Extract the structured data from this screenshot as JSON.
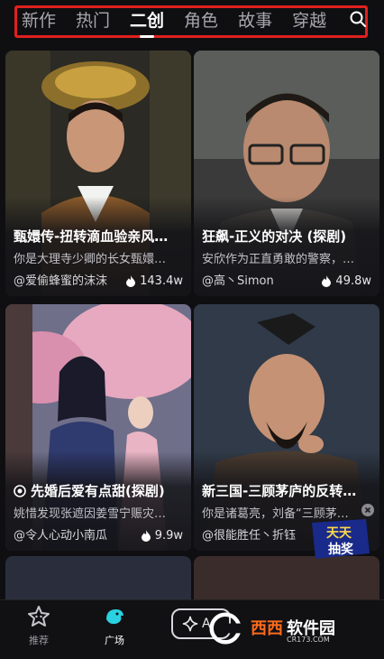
{
  "tabs": [
    {
      "label": "新作",
      "active": false
    },
    {
      "label": "热门",
      "active": false
    },
    {
      "label": "二创",
      "active": true
    },
    {
      "label": "角色",
      "active": false
    },
    {
      "label": "故事",
      "active": false
    },
    {
      "label": "穿越",
      "active": false
    }
  ],
  "search_icon": "search-icon",
  "cards": [
    {
      "title": "甄嬛传-扭转滴血验亲风…",
      "desc": "你是大理寺少卿的长女甄嬛…",
      "author": "@爱偷蜂蜜的沫沫",
      "count": "143.4w"
    },
    {
      "title": "狂飙-正义的对决 (探剧)",
      "desc": "安欣作为正直勇敢的警察，…",
      "author": "@高丶Simon",
      "count": "49.8w"
    },
    {
      "title": "先婚后爱有点甜(探剧)",
      "desc": "姚惜发现张遮因姜雪宁赈灾…",
      "author": "@令人心动小南瓜",
      "count": "9.9w"
    },
    {
      "title": "新三国-三顾茅庐的反转…",
      "desc": "你是诸葛亮，刘备“三顾茅…",
      "author": "@很能胜任丶折钰",
      "count": ""
    }
  ],
  "bottom_nav": [
    {
      "label": "推荐",
      "icon": "star-face-icon",
      "active": false
    },
    {
      "label": "广场",
      "icon": "bird-icon",
      "active": true
    },
    {
      "label": "A",
      "icon": "sparkle-icon",
      "active": false
    }
  ],
  "promo_badge": {
    "line1": "天天",
    "line2": "抽奖"
  },
  "watermark": {
    "brand": "西西",
    "text": "软件园",
    "url": "CR173.COM"
  },
  "colors": {
    "accent_red": "#e0201e",
    "active_nav": "#2ad1e0",
    "background": "#0f0f12"
  }
}
